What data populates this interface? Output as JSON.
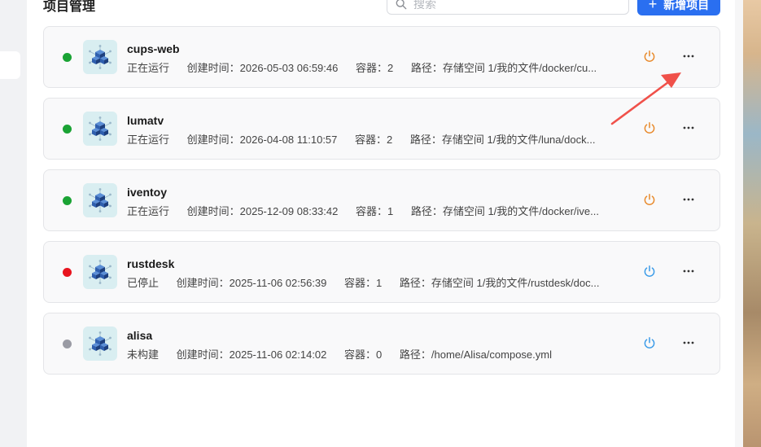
{
  "header": {
    "title": "项目管理",
    "search_placeholder": "搜索",
    "new_button_label": "新增项目"
  },
  "colors": {
    "running": "#1aa334",
    "stopped": "#e8141e",
    "unbuilt": "#9a9ba4",
    "power_active": "#e8892a",
    "power_inactive": "#3a9be8",
    "accent": "#2a6ff0"
  },
  "projects": [
    {
      "name": "cups-web",
      "status": "正在运行",
      "status_color": "#1aa334",
      "created": "创建时间：2026-05-03 06:59:46",
      "containers": "容器：2",
      "path": "路径：存储空间 1/我的文件/docker/cu...",
      "power_color": "#e8892a"
    },
    {
      "name": "lumatv",
      "status": "正在运行",
      "status_color": "#1aa334",
      "created": "创建时间：2026-04-08 11:10:57",
      "containers": "容器：2",
      "path": "路径：存储空间 1/我的文件/luna/dock...",
      "power_color": "#e8892a"
    },
    {
      "name": "iventoy",
      "status": "正在运行",
      "status_color": "#1aa334",
      "created": "创建时间：2025-12-09 08:33:42",
      "containers": "容器：1",
      "path": "路径：存储空间 1/我的文件/docker/ive...",
      "power_color": "#e8892a"
    },
    {
      "name": "rustdesk",
      "status": "已停止",
      "status_color": "#e8141e",
      "created": "创建时间：2025-11-06 02:56:39",
      "containers": "容器：1",
      "path": "路径：存储空间 1/我的文件/rustdesk/doc...",
      "power_color": "#3a9be8"
    },
    {
      "name": "alisa",
      "status": "未构建",
      "status_color": "#9a9ba4",
      "created": "创建时间：2025-11-06 02:14:02",
      "containers": "容器：0",
      "path": "路径：/home/Alisa/compose.yml",
      "power_color": "#3a9be8"
    }
  ],
  "icons": {
    "search": "search-icon",
    "app": "docker-cubes-icon",
    "power": "power-icon",
    "more": "more-horizontal-icon",
    "annotation": "red-arrow-icon"
  }
}
